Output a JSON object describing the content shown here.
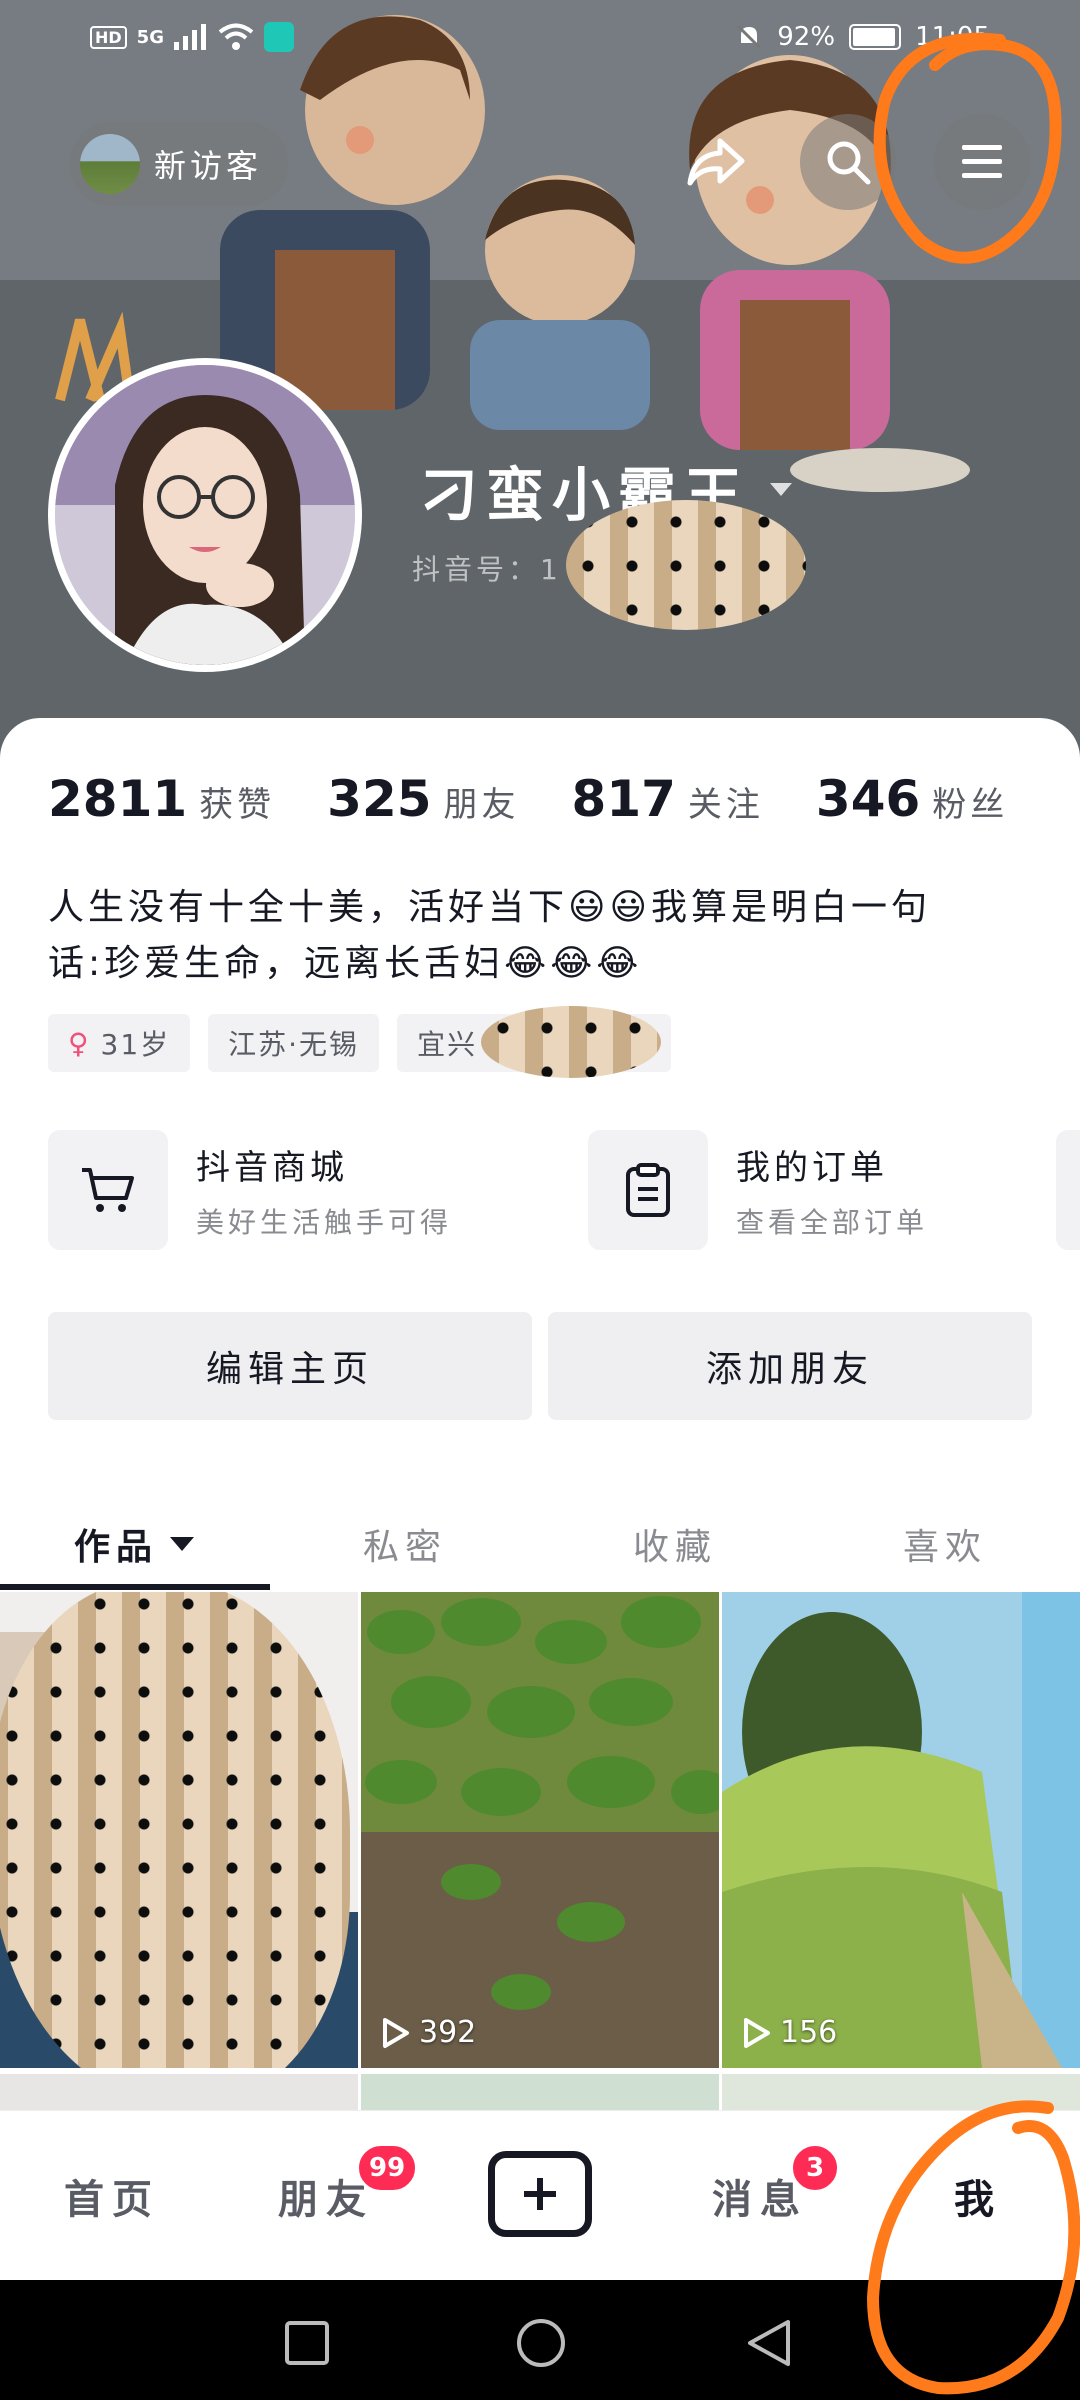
{
  "status_bar": {
    "network": "HD",
    "signal_gen": "5G",
    "battery_pct": "92%",
    "time": "11:05"
  },
  "header": {
    "visitor_label": "新访客"
  },
  "profile": {
    "nickname": "刁蛮小霸王",
    "douyin_id_label": "抖音号：1",
    "stats": [
      {
        "num": "2811",
        "label": "获赞"
      },
      {
        "num": "325",
        "label": "朋友"
      },
      {
        "num": "817",
        "label": "关注"
      },
      {
        "num": "346",
        "label": "粉丝"
      }
    ],
    "bio_line1": "人生没有十全十美，活好当下😃😃我算是明白一句",
    "bio_line2": "话:珍爱生命，远离长舌妇😂😂😂",
    "tags": {
      "age": "31岁",
      "location": "江苏·无锡",
      "area": "宜兴"
    }
  },
  "shortcuts": [
    {
      "title": "抖音商城",
      "subtitle": "美好生活触手可得"
    },
    {
      "title": "我的订单",
      "subtitle": "查看全部订单"
    }
  ],
  "actions": {
    "edit_profile": "编辑主页",
    "add_friend": "添加朋友"
  },
  "tabs": [
    "作品",
    "私密",
    "收藏",
    "喜欢"
  ],
  "videos": [
    {
      "plays": ""
    },
    {
      "plays": "392"
    },
    {
      "plays": "156"
    }
  ],
  "bottom_nav": {
    "home": "首页",
    "friends": "朋友",
    "friends_badge": "99",
    "messages": "消息",
    "messages_badge": "3",
    "me": "我"
  },
  "colors": {
    "accent": "#fe2c55",
    "annotation": "#ff7a1a",
    "text": "#161823"
  }
}
